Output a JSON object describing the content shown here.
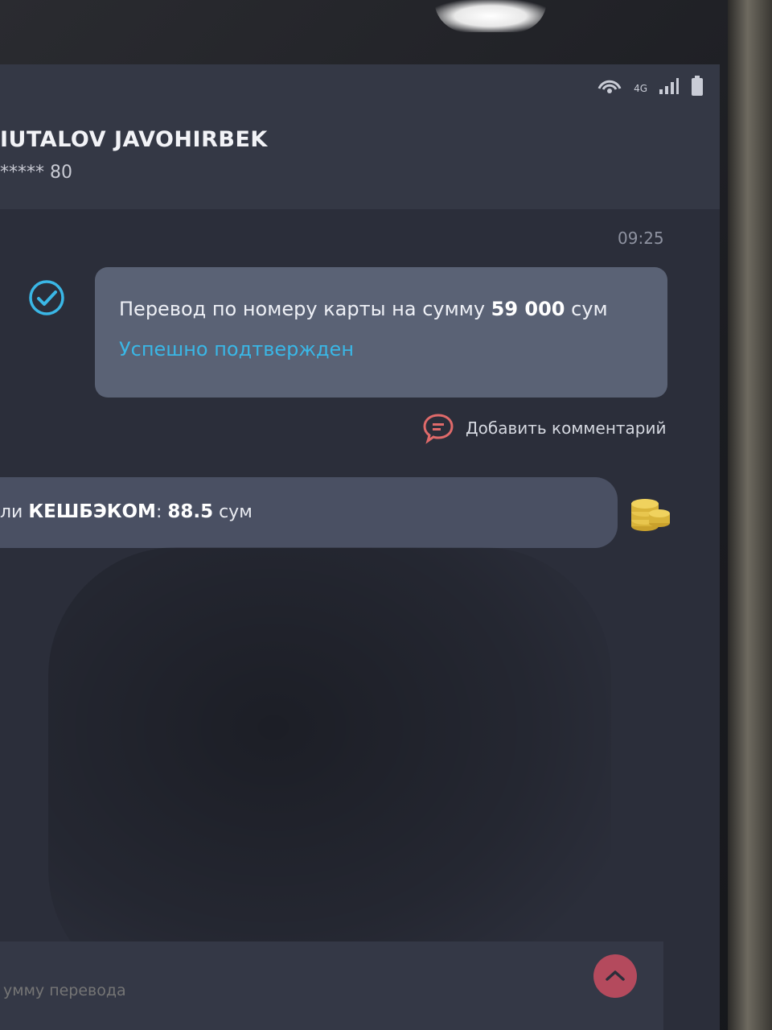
{
  "status_bar": {
    "icons": [
      "hotspot-icon",
      "4g-icon",
      "signal-icon",
      "battery-icon"
    ],
    "network_label": "4G"
  },
  "header": {
    "contact_name": "IUTALOV JAVOHIRBEK",
    "card_masked": "***** 80"
  },
  "message": {
    "time": "09:25",
    "text_prefix": "Перевод по номеру карты на сумму ",
    "amount": "59 000",
    "currency": "сум",
    "status": "Успешно подтвержден",
    "status_color": "#3ab7e6"
  },
  "comment": {
    "label": "Добавить комментарий"
  },
  "cashback": {
    "prefix": "ли ",
    "brand": "КЕШБЭКОМ",
    "separator": ": ",
    "amount": "88.5",
    "currency": " сум"
  },
  "input": {
    "placeholder": "умму перевода"
  },
  "colors": {
    "accent": "#3ab7e6",
    "send_button": "#b44a5d",
    "comment_icon": "#e06a6a",
    "coins": "#d9b43a"
  }
}
